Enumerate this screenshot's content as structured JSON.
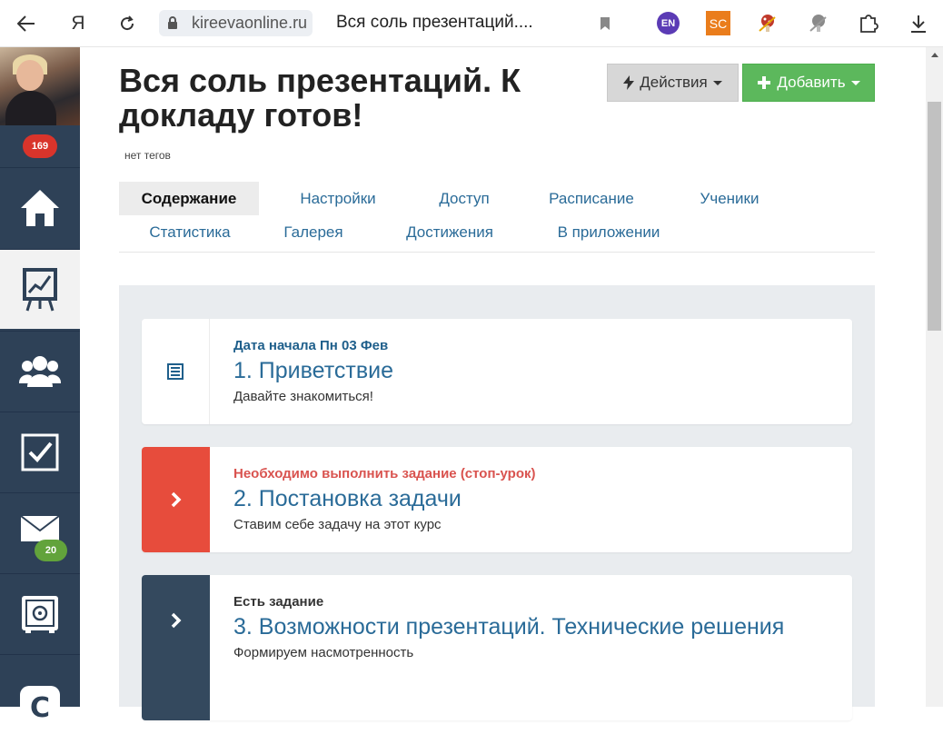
{
  "browser": {
    "domain": "kireevaonline.ru",
    "tab_title": "Вся соль презентаций....",
    "yandex_label": "Я",
    "ext_en": "EN",
    "ext_sc": "SC"
  },
  "sidebar": {
    "notifications_count": "169",
    "messages_count": "20",
    "items": [
      {
        "name": "home",
        "icon": "home-icon"
      },
      {
        "name": "trainings",
        "icon": "presentation-chart-icon",
        "active": true
      },
      {
        "name": "users",
        "icon": "users-icon"
      },
      {
        "name": "tasks",
        "icon": "checkbox-icon"
      },
      {
        "name": "messages",
        "icon": "envelope-icon"
      },
      {
        "name": "safe",
        "icon": "safe-icon"
      },
      {
        "name": "crm",
        "icon": "c-logo-icon"
      }
    ]
  },
  "header": {
    "title": "Вся соль презентаций. К докладу готов!",
    "tags": "нет тегов",
    "actions_label": "Действия",
    "add_label": "Добавить"
  },
  "tabs": [
    {
      "label": "Содержание",
      "active": true
    },
    {
      "label": "Настройки"
    },
    {
      "label": "Доступ"
    },
    {
      "label": "Расписание"
    },
    {
      "label": "Ученики"
    },
    {
      "label": "Статистика"
    },
    {
      "label": "Галерея"
    },
    {
      "label": "Достижения"
    },
    {
      "label": "В приложении"
    }
  ],
  "lessons": [
    {
      "status": "Дата начала Пн 03 Фев",
      "status_color": "#1f5f8b",
      "title": "1. Приветствие",
      "description": "Давайте знакомиться!",
      "icon": "list-icon"
    },
    {
      "status": "Необходимо выполнить задание (стоп-урок)",
      "status_color": "#d9534f",
      "title": "2. Постановка задачи",
      "description": "Ставим себе задачу на этот курс",
      "icon": "chevron-right-icon"
    },
    {
      "status": "Есть задание",
      "status_color": "#333333",
      "title": "3. Возможности презентаций. Технические решения",
      "description": "Формируем насмотренность",
      "icon": "chevron-right-icon"
    }
  ],
  "colors": {
    "sidebar_bg": "#2e4157",
    "link_blue": "#2a6b98",
    "add_green": "#5cb85c",
    "stop_red": "#e74c3c",
    "dark_slate": "#34495e"
  }
}
